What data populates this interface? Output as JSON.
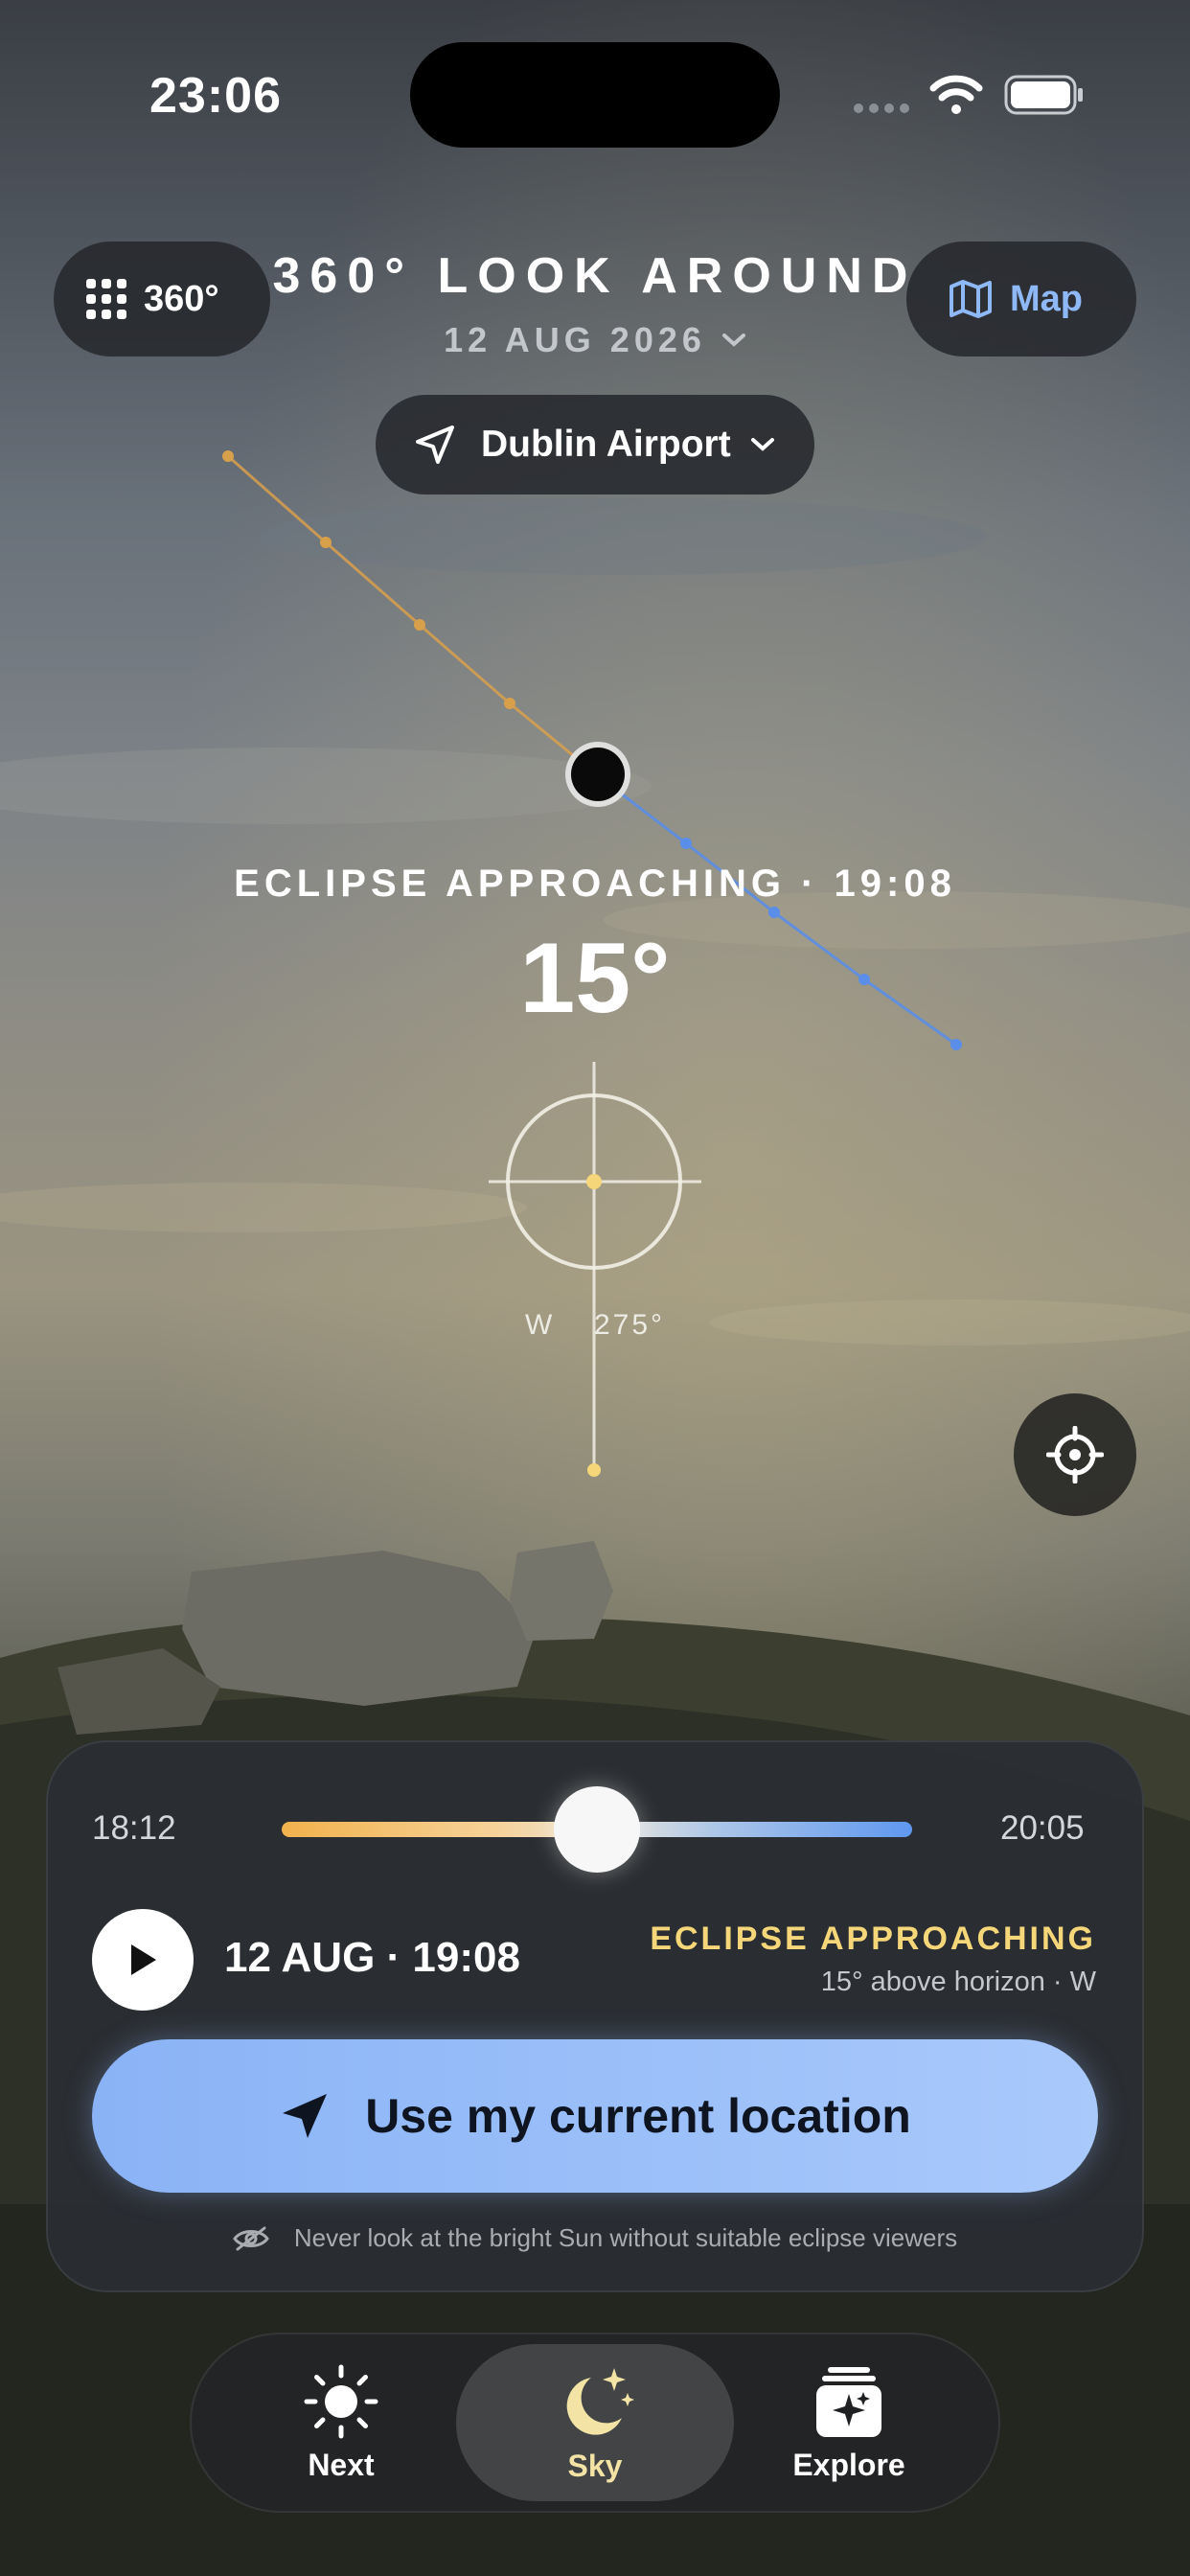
{
  "status_bar": {
    "time": "23:06"
  },
  "header": {
    "mode_button_label": "360°",
    "title": "360° LOOK AROUND",
    "date": "12 AUG 2026",
    "map_button_label": "Map",
    "location_label": "Dublin Airport"
  },
  "sky": {
    "event_label": "ECLIPSE APPROACHING · 19:08",
    "altitude": "15°",
    "direction_letter": "W",
    "azimuth": "275°"
  },
  "panel": {
    "start_time": "18:12",
    "end_time": "20:05",
    "slider_position": 0.5,
    "current_datetime": "12 AUG · 19:08",
    "status_title": "ECLIPSE APPROACHING",
    "status_detail": "15° above horizon · W",
    "cta_label": "Use my current location",
    "warning": "Never look at the bright Sun without suitable eclipse viewers"
  },
  "tab_bar": {
    "tabs": [
      {
        "label": "Next",
        "icon": "sun-icon",
        "active": false
      },
      {
        "label": "Sky",
        "icon": "moon-stars-icon",
        "active": true
      },
      {
        "label": "Explore",
        "icon": "explore-cards-icon",
        "active": false
      }
    ]
  },
  "colors": {
    "accent_blue": "#8fb8f7",
    "gold": "#f5d77a",
    "path_orange": "#e0a24a",
    "path_blue": "#5a8ee8"
  }
}
